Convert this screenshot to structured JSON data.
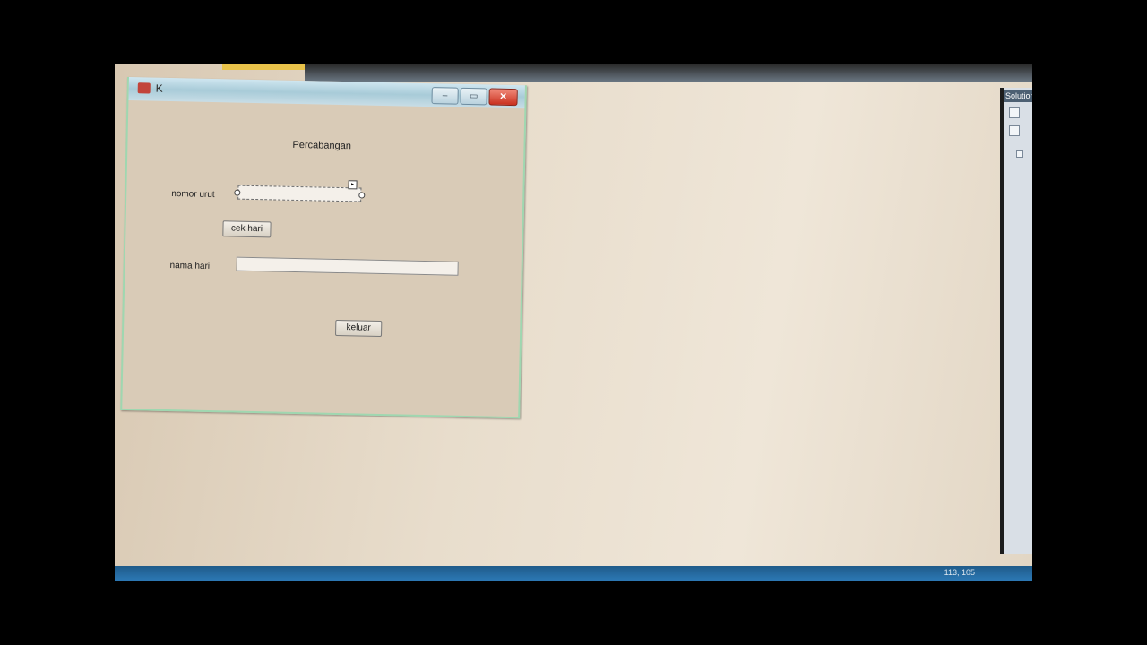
{
  "window": {
    "title": "K",
    "minimize_glyph": "–",
    "maximize_glyph": "▭",
    "close_glyph": "✕"
  },
  "form": {
    "caption": "Percabangan",
    "nomor_urut_label": "nomor urut",
    "nomor_urut_value": "",
    "cek_button_label": "cek hari",
    "nama_hari_label": "nama hari",
    "nama_hari_value": "",
    "keluar_button_label": "keluar"
  },
  "ide": {
    "solution_panel_title": "Solution",
    "status_coords": "113, 105"
  },
  "colors": {
    "close_button": "#c9301e",
    "titlebar": "#a8cbd8",
    "form_background": "#d9cbb7",
    "statusbar": "#2c78b4"
  }
}
